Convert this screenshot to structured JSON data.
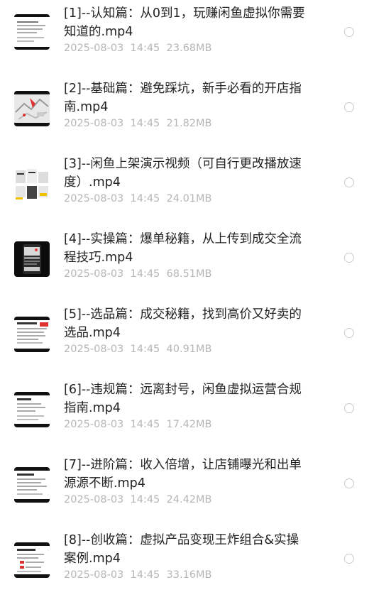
{
  "files": [
    {
      "title": "[1]--认知篇：从0到1，玩赚闲鱼虚拟你需要\n知道的.mp4",
      "date": "2025-08-03",
      "time": "14:45",
      "size": "23.68MB",
      "thumb": "doc-thumbnail-icon"
    },
    {
      "title": "[2]--基础篇：避免踩坑，新手必看的开店指\n南.mp4",
      "date": "2025-08-03",
      "time": "14:45",
      "size": "21.82MB",
      "thumb": "map-thumbnail-icon"
    },
    {
      "title": "[3]--闲鱼上架演示视频（可自行更改播放速\n度）.mp4",
      "date": "2025-08-03",
      "time": "14:45",
      "size": "24.01MB",
      "thumb": "screenshots-thumbnail-icon"
    },
    {
      "title": "[4]--实操篇：爆单秘籍，从上传到成交全流\n程技巧.mp4",
      "date": "2025-08-03",
      "time": "14:45",
      "size": "68.51MB",
      "thumb": "phone-thumbnail-icon"
    },
    {
      "title": "[5]--选品篇：成交秘籍，找到高价又好卖的\n选品.mp4",
      "date": "2025-08-03",
      "time": "14:45",
      "size": "40.91MB",
      "thumb": "doc-thumbnail-icon"
    },
    {
      "title": "[6]--违规篇：远离封号，闲鱼虚拟运营合规\n指南.mp4",
      "date": "2025-08-03",
      "time": "14:45",
      "size": "17.42MB",
      "thumb": "doc-thumbnail-icon"
    },
    {
      "title": "[7]--进阶篇：收入倍增，让店铺曝光和出单\n源源不断.mp4",
      "date": "2025-08-03",
      "time": "14:45",
      "size": "24.42MB",
      "thumb": "doc-thumbnail-icon"
    },
    {
      "title": "[8]--创收篇：虚拟产品变现王炸组合&实操\n案例.mp4",
      "date": "2025-08-03",
      "time": "14:45",
      "size": "33.16MB",
      "thumb": "doc-thumbnail-icon"
    }
  ],
  "colors": {
    "title": "#222222",
    "meta": "#b6b6b6",
    "radio_border": "#c9c9c9",
    "background": "#ffffff"
  }
}
